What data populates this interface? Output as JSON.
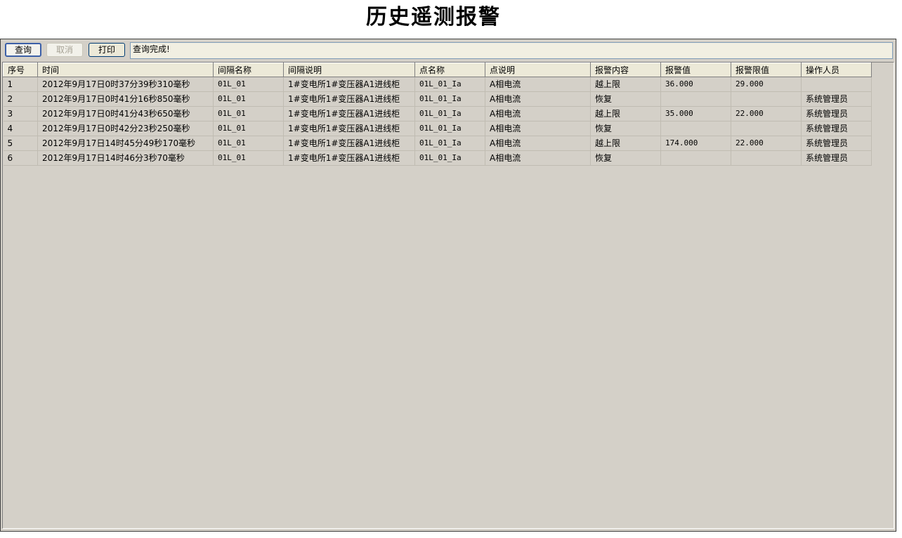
{
  "page": {
    "title": "历史遥测报警"
  },
  "toolbar": {
    "query_label": "查询",
    "cancel_label": "取消",
    "print_label": "打印",
    "status_text": "查询完成!"
  },
  "table": {
    "columns": [
      "序号",
      "时间",
      "间隔名称",
      "间隔说明",
      "点名称",
      "点说明",
      "报警内容",
      "报警值",
      "报警限值",
      "操作人员"
    ],
    "rows": [
      [
        "1",
        "2012年9月17日0时37分39秒310毫秒",
        "01L_01",
        "1#变电所1#变压器A1进线柜",
        "01L_01_Ia",
        "A相电流",
        "越上限",
        "36.000",
        "29.000",
        ""
      ],
      [
        "2",
        "2012年9月17日0时41分16秒850毫秒",
        "01L_01",
        "1#变电所1#变压器A1进线柜",
        "01L_01_Ia",
        "A相电流",
        "恢复",
        "",
        "",
        "系统管理员"
      ],
      [
        "3",
        "2012年9月17日0时41分43秒650毫秒",
        "01L_01",
        "1#变电所1#变压器A1进线柜",
        "01L_01_Ia",
        "A相电流",
        "越上限",
        "35.000",
        "22.000",
        "系统管理员"
      ],
      [
        "4",
        "2012年9月17日0时42分23秒250毫秒",
        "01L_01",
        "1#变电所1#变压器A1进线柜",
        "01L_01_Ia",
        "A相电流",
        "恢复",
        "",
        "",
        "系统管理员"
      ],
      [
        "5",
        "2012年9月17日14时45分49秒170毫秒",
        "01L_01",
        "1#变电所1#变压器A1进线柜",
        "01L_01_Ia",
        "A相电流",
        "越上限",
        "174.000",
        "22.000",
        "系统管理员"
      ],
      [
        "6",
        "2012年9月17日14时46分3秒70毫秒",
        "01L_01",
        "1#变电所1#变压器A1进线柜",
        "01L_01_Ia",
        "A相电流",
        "恢复",
        "",
        "",
        "系统管理员"
      ]
    ]
  }
}
